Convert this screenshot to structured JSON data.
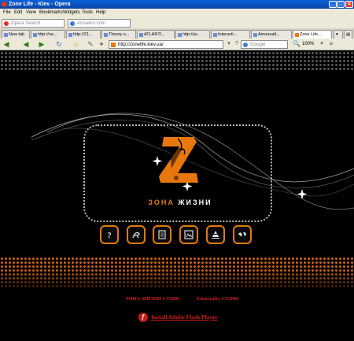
{
  "window": {
    "title": "Zone Life - Kiev - Opera"
  },
  "menu": [
    "File",
    "Edit",
    "View",
    "Bookmarks",
    "Widgets",
    "Tools",
    "Help"
  ],
  "search": {
    "opera_placeholder": "Opera Search",
    "answers_placeholder": "Answers.com"
  },
  "tabs": [
    {
      "label": "New tab"
    },
    {
      "label": "http://ne..."
    },
    {
      "label": "http://21..."
    },
    {
      "label": "Theory o..."
    },
    {
      "label": "ATLANTI..."
    },
    {
      "label": "http://ar..."
    },
    {
      "label": "Interacti..."
    },
    {
      "label": "Amoneall..."
    },
    {
      "label": "Zone Life..."
    }
  ],
  "nav": {
    "address": "http://zonelife.kiev.ua/",
    "search_engine": "Google",
    "zoom": "100%"
  },
  "site": {
    "brand_part1": "ЗОНА",
    "brand_part2": "ЖИЗНИ",
    "footer_left": "ЗОНА ЖИЗНИ СТ2006",
    "footer_right": "Etnocrafty СТ2006",
    "flash_label": "Install Adobe Flash Player",
    "icons": [
      "question-icon",
      "dragon-icon",
      "document-icon",
      "gallery-icon",
      "temple-icon",
      "world-map-icon"
    ]
  },
  "colors": {
    "accent": "#e8780e",
    "footer_red": "#d31c1c",
    "background": "#000000"
  }
}
